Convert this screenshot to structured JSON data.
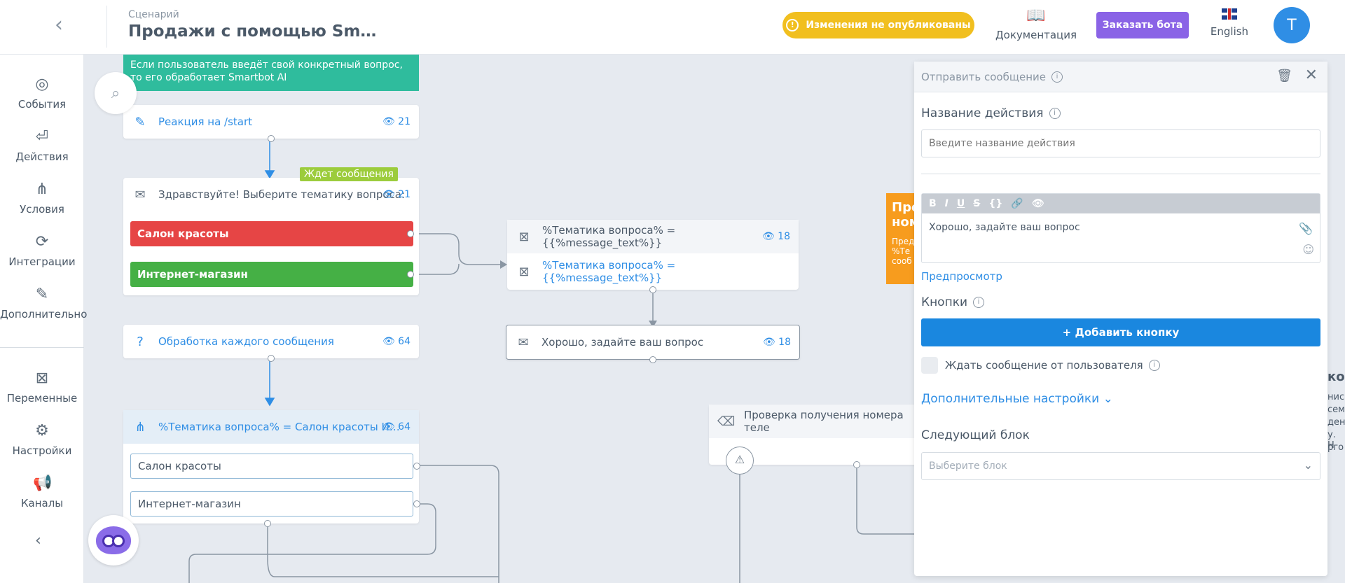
{
  "header": {
    "breadcrumb": "Сценарий",
    "title": "Продажи с помощью Sm…",
    "unpublished_notice": "Изменения не опубликованы",
    "docs_label": "Документация",
    "order_bot_label": "Заказать бота",
    "language_label": "English",
    "avatar_initial": "T"
  },
  "sidebar": {
    "items": [
      {
        "label": "События",
        "icon": "target-icon"
      },
      {
        "label": "Действия",
        "icon": "action-icon"
      },
      {
        "label": "Условия",
        "icon": "conditions-icon"
      },
      {
        "label": "Интеграции",
        "icon": "integrations-icon"
      },
      {
        "label": "Дополнительно",
        "icon": "edit-icon"
      },
      {
        "label": "Переменные",
        "icon": "variable-icon"
      },
      {
        "label": "Настройки",
        "icon": "gear-icon"
      },
      {
        "label": "Каналы",
        "icon": "megaphone-icon"
      }
    ]
  },
  "canvas": {
    "note": "Если пользователь введёт свой конкретный вопрос, то его обработает Smartbot AI",
    "start_node": {
      "title": "Реакция на /start",
      "count": "21"
    },
    "greet_node": {
      "title": "Здравствуйте! Выберите тематику вопроса:",
      "count": "21",
      "badge": "Ждет сообщения",
      "options": [
        "Салон красоты",
        "Интернет-магазин"
      ]
    },
    "each_msg_node": {
      "title": "Обработка каждого сообщения",
      "count": "64"
    },
    "condition_node": {
      "title": "%Тематика вопроса% = Салон красоты И…",
      "count": "64",
      "options": [
        "Салон красоты",
        "Интернет-магазин"
      ]
    },
    "var_node": {
      "title": "%Тематика вопроса% = {{%message_text%}}",
      "count": "18",
      "row": "%Тематика вопроса% = {{%message_text%}}"
    },
    "reply_node": {
      "title": "Хорошо, задайте ваш вопрос",
      "count": "18"
    },
    "phone_node": {
      "title": "Проверка получения номера теле"
    },
    "orange_node": {
      "title": "Пре ном",
      "text": "Пред %Те сооб"
    }
  },
  "panel": {
    "header": "Отправить сообщение",
    "action_name_label": "Название действия",
    "action_name_placeholder": "Введите название действия",
    "message_text": "Хорошо, задайте ваш вопрос",
    "preview_link": "Предпросмотр",
    "buttons_label": "Кнопки",
    "add_button_label": "+ Добавить кнопку",
    "wait_checkbox_label": "Ждать сообщение от пользователя",
    "advanced_link": "Дополнительные настройки",
    "next_block_label": "Следующий блок",
    "next_block_placeholder": "Выберите блок"
  },
  "peek_text": [
    "ко",
    "нис",
    "сем",
    "дени",
    "у. Н",
    "рго"
  ],
  "colors": {
    "accent": "#2f8ee5",
    "warning": "#f1bf1f",
    "purple": "#8a63e6",
    "red": "#e64545",
    "green": "#45b045",
    "teal": "#2fbc9d",
    "orange": "#f79c1e"
  }
}
